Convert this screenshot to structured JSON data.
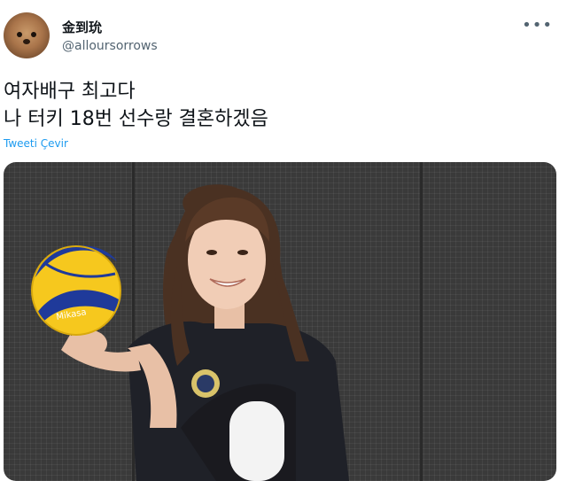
{
  "author": {
    "display_name": "金到玧",
    "handle": "@alloursorrows",
    "avatar_icon": "dog-avatar-icon"
  },
  "more_icon": "more-options-icon",
  "tweet": {
    "lines": [
      "여자배구 최고다",
      "나 터키 18번 선수랑 결혼하겠음"
    ],
    "translate_label": "Tweeti Çevir"
  },
  "media": {
    "ball_brand": "Mikasa"
  },
  "colors": {
    "link": "#1d9bf0",
    "secondary_text": "#536471",
    "primary_text": "#0f1419"
  }
}
